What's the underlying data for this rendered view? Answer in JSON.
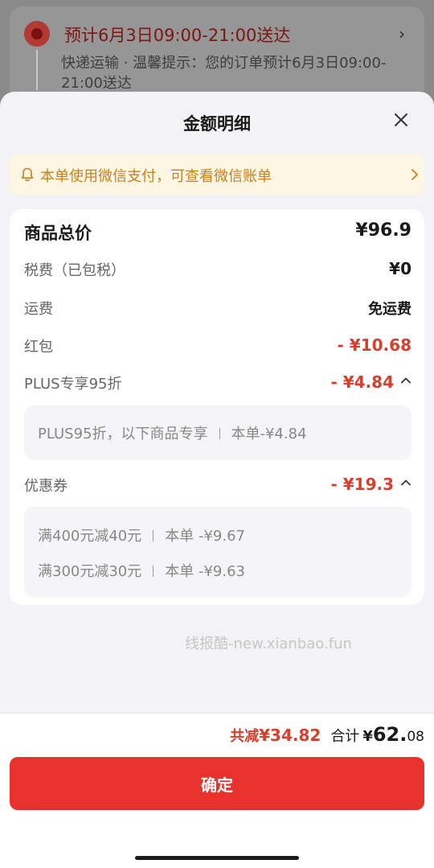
{
  "background": {
    "delivery_title": "预计6月3日09:00-21:00送达",
    "delivery_sub": "快递运输 · 温馨提示：您的订单预计6月3日09:00-21:00送达"
  },
  "sheet": {
    "title": "金额明细",
    "notice": "本单使用微信支付，可查看微信账单"
  },
  "details": {
    "goods_total": {
      "label": "商品总价",
      "value": "¥96.9"
    },
    "tax": {
      "label": "税费（已包税）",
      "value": "¥0"
    },
    "shipping": {
      "label": "运费",
      "value": "免运费"
    },
    "red_packet": {
      "label": "红包",
      "value": "- ¥10.68"
    },
    "plus": {
      "label": "PLUS专享95折",
      "value": "- ¥4.84",
      "sub_name": "PLUS95折，以下商品专享",
      "sub_amount": "本单-¥4.84"
    },
    "coupon": {
      "label": "优惠券",
      "value": "- ¥19.3",
      "items": [
        {
          "name": "满400元减40元",
          "amount": "本单 -¥9.67"
        },
        {
          "name": "满300元减30元",
          "amount": "本单 -¥9.63"
        }
      ]
    }
  },
  "watermark": "线报酷-new.xianbao.fun",
  "footer": {
    "save_label": "共减",
    "save_value": "¥34.82",
    "sum_label": "合计",
    "sum_yen": "¥",
    "sum_int": "62.",
    "sum_dec": "08",
    "confirm_label": "确定"
  },
  "colors": {
    "accent": "#e8322e",
    "discount": "#d6402d",
    "notice_text": "#c8811c",
    "notice_bg": "#fdf6e3"
  }
}
